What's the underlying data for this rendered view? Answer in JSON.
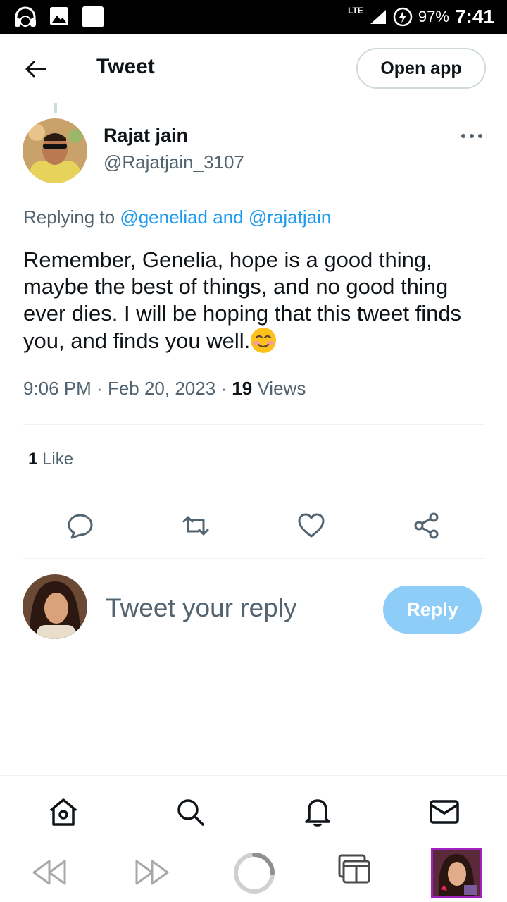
{
  "status_bar": {
    "network": "LTE",
    "battery": "97%",
    "time": "7:41"
  },
  "header": {
    "title": "Tweet",
    "open_app": "Open app"
  },
  "tweet": {
    "author_name": "Rajat jain",
    "author_handle": "@Rajatjain_3107",
    "replying_prefix": "Replying to",
    "replying_mentions": "@geneliad and @rajatjain",
    "text": "Remember, Genelia, hope is a good thing, maybe the best of things, and no good thing ever dies. I will be hoping that this tweet finds you, and finds you well.",
    "time": "9:06 PM",
    "date": "Feb 20, 2023",
    "views_count": "19",
    "views_label": "Views",
    "likes_count": "1",
    "likes_label": "Like"
  },
  "reply": {
    "placeholder": "Tweet your reply",
    "button": "Reply"
  },
  "icons": {
    "actions": [
      "reply-icon",
      "retweet-icon",
      "like-icon",
      "share-icon"
    ],
    "bottom_nav": [
      "home-icon",
      "search-icon",
      "notifications-icon",
      "messages-icon"
    ],
    "browser": [
      "back-icon",
      "forward-icon",
      "loading-icon",
      "tabs-icon",
      "profile-icon"
    ]
  },
  "colors": {
    "link": "#1d9bf0",
    "secondary_text": "#536471",
    "reply_button": "#8ecdf8"
  }
}
